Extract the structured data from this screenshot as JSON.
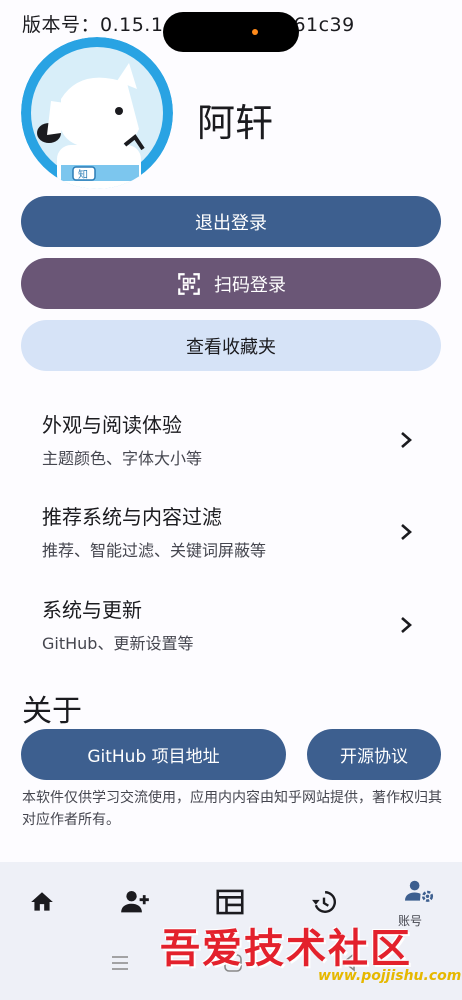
{
  "header": {
    "version_text": "版本号：0.15.1",
    "version_suffix": "61c39"
  },
  "profile": {
    "username": "阿轩",
    "avatar_badge": "知"
  },
  "actions": {
    "logout_label": "退出登录",
    "scan_login_label": "扫码登录",
    "favorites_label": "查看收藏夹"
  },
  "settings": {
    "items": [
      {
        "title": "外观与阅读体验",
        "subtitle": "主题颜色、字体大小等"
      },
      {
        "title": "推荐系统与内容过滤",
        "subtitle": "推荐、智能过滤、关键词屏蔽等"
      },
      {
        "title": "系统与更新",
        "subtitle": "GitHub、更新设置等"
      }
    ]
  },
  "about": {
    "title": "关于",
    "github_label": "GitHub 项目地址",
    "license_label": "开源协议",
    "disclaimer": "本软件仅供学习交流使用，应用内内容由知乎网站提供，著作权归其对应作者所有。"
  },
  "bottom_nav": {
    "items": [
      {
        "icon": "home-icon"
      },
      {
        "icon": "person-add-icon"
      },
      {
        "icon": "dashboard-icon"
      },
      {
        "icon": "history-icon"
      },
      {
        "icon": "account-settings-icon",
        "label": "账号"
      }
    ]
  },
  "watermark": {
    "text": "吾爱技术社区",
    "url": "www.pojjishu.com"
  },
  "colors": {
    "primary": "#3d5f8f",
    "secondary": "#6a5676",
    "tertiary_container": "#d6e3f7",
    "nav_background": "#eef0f7"
  }
}
